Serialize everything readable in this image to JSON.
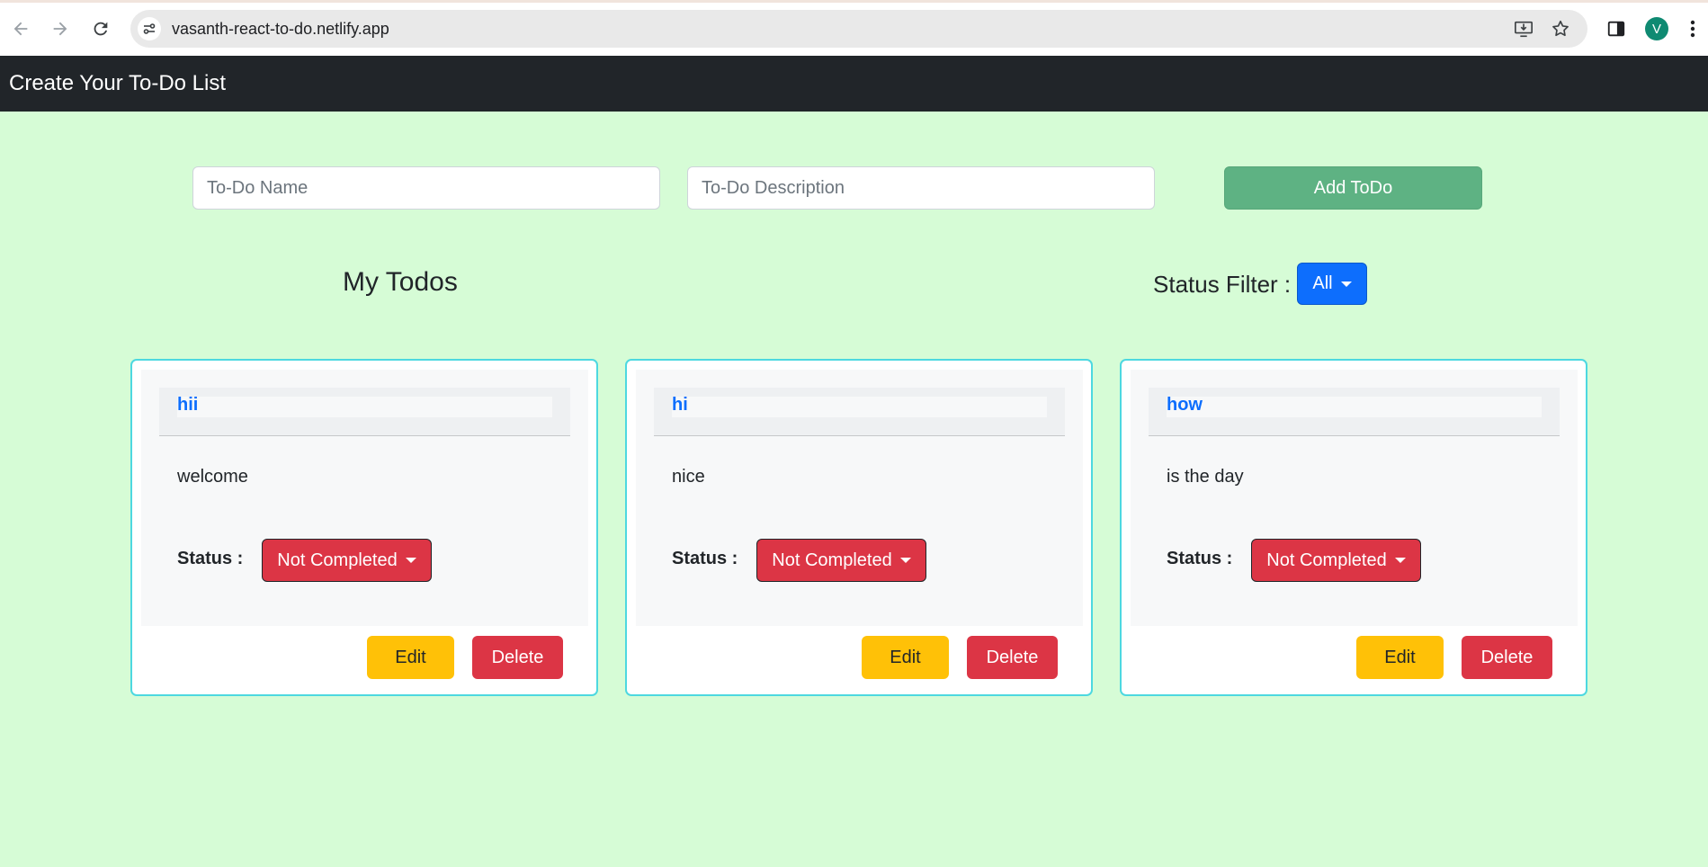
{
  "browser": {
    "url": "vasanth-react-to-do.netlify.app",
    "profile_initial": "V"
  },
  "navbar": {
    "title": "Create Your To-Do List"
  },
  "form": {
    "name_placeholder": "To-Do Name",
    "name_value": "",
    "description_placeholder": "To-Do Description",
    "description_value": "",
    "add_button_label": "Add ToDo"
  },
  "list": {
    "heading": "My Todos",
    "filter_label": "Status Filter :",
    "filter_value": "All"
  },
  "todos": [
    {
      "name": "hii",
      "description": "welcome",
      "status_label": "Status :",
      "status": "Not Completed",
      "edit_label": "Edit",
      "delete_label": "Delete"
    },
    {
      "name": "hi",
      "description": "nice",
      "status_label": "Status :",
      "status": "Not Completed",
      "edit_label": "Edit",
      "delete_label": "Delete"
    },
    {
      "name": "how",
      "description": "is the day",
      "status_label": "Status :",
      "status": "Not Completed",
      "edit_label": "Edit",
      "delete_label": "Delete"
    }
  ],
  "colors": {
    "background": "#d6fcd6",
    "navbar": "#212529",
    "add_button": "#5eb283",
    "filter_button": "#0d6efd",
    "card_border": "#4dd8e0",
    "status_not_completed": "#dc3545",
    "edit_button": "#ffc107",
    "delete_button": "#dc3545",
    "todo_name": "#0d6efd"
  },
  "icons": [
    "back-arrow-icon",
    "forward-arrow-icon",
    "reload-icon",
    "site-info-icon",
    "install-app-icon",
    "bookmark-star-icon",
    "side-panel-icon",
    "more-menu-icon"
  ]
}
